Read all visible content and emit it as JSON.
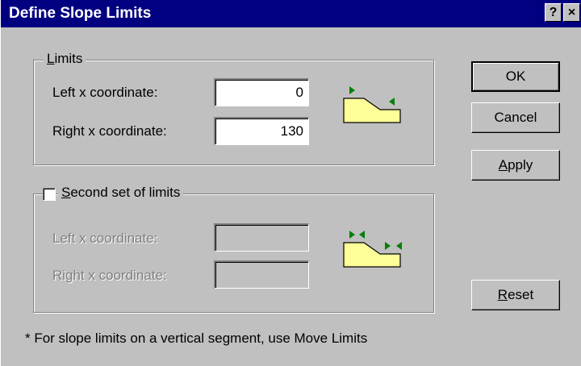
{
  "window": {
    "title": "Define Slope Limits",
    "help_button": "?",
    "close_button": "×"
  },
  "limits_group": {
    "legend_key": "L",
    "legend_rest": "imits",
    "left_label": "Left x coordinate:",
    "left_value": "0",
    "right_label": "Right x coordinate:",
    "right_value": "130",
    "icon": "slope-limits-icon"
  },
  "second_group": {
    "checked": false,
    "legend_key": "S",
    "legend_rest": "econd set of limits",
    "left_label": "Left x coordinate:",
    "left_value": "",
    "right_label": "Right x coordinate:",
    "right_value": "",
    "icon": "second-slope-limits-icon"
  },
  "buttons": {
    "ok": "OK",
    "cancel": "Cancel",
    "apply_key": "A",
    "apply_rest": "pply",
    "reset_key": "R",
    "reset_rest": "eset"
  },
  "footnote": "* For slope limits on a vertical segment, use Move Limits",
  "colors": {
    "title_bar": "#000080",
    "face": "#c0c0c0",
    "slope_fill": "#ffff99",
    "marker": "#008000"
  }
}
